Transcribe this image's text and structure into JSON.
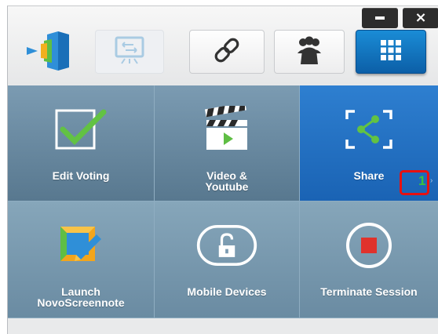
{
  "window": {
    "minimize_icon": "minimize-icon",
    "close_icon": "close-icon",
    "close_glyph": "×"
  },
  "toolbar": {
    "buttons": [
      {
        "icon": "novo-logo-icon"
      },
      {
        "icon": "presentation-screen-icon",
        "state": "disabled"
      },
      {
        "icon": "link-icon"
      },
      {
        "icon": "users-group-icon"
      },
      {
        "icon": "grid-menu-icon",
        "state": "active"
      }
    ]
  },
  "tiles": [
    {
      "id": "edit-voting",
      "label": "Edit Voting",
      "icon": "checkbox-check-icon"
    },
    {
      "id": "video-youtube",
      "label": "Video &\nYoutube",
      "icon": "clapperboard-play-icon"
    },
    {
      "id": "share",
      "label": "Share",
      "icon": "share-icon",
      "selected": true,
      "marker": "1",
      "marker_color": "#39c23d"
    },
    {
      "id": "launch-novoscreennote",
      "label": "Launch\nNovoScreennote",
      "icon": "screennote-icon"
    },
    {
      "id": "mobile-devices",
      "label": "Mobile Devices",
      "icon": "unlock-icon"
    },
    {
      "id": "terminate-session",
      "label": "Terminate Session",
      "icon": "stop-icon"
    }
  ],
  "colors": {
    "tile": "#6a8aa1",
    "share_tile": "#2470c4",
    "active_toolbar": "#1078c8",
    "highlight_box": "#e81010",
    "check_green": "#62c243",
    "stop_red": "#e0322c"
  }
}
